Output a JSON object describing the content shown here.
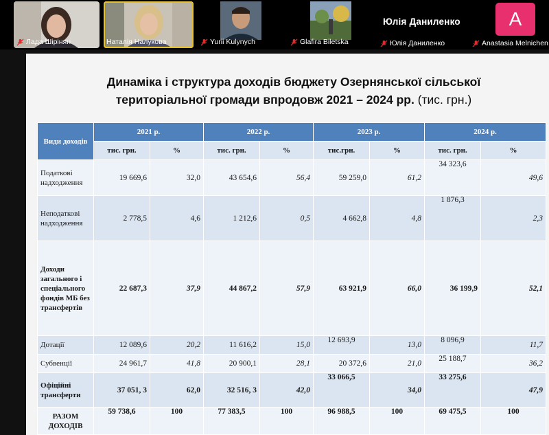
{
  "participants": [
    {
      "name": "Лада Шірінян",
      "mic": "muted"
    },
    {
      "name": "Наталія Налукова",
      "mic": "on",
      "active": true
    },
    {
      "name": "Yurii Kulynych",
      "mic": "muted"
    },
    {
      "name": "Glafira Biletska",
      "mic": "muted"
    },
    {
      "name": "Юлія Даниленко",
      "mic": "muted"
    },
    {
      "name": "Anastasia Melnichen",
      "mic": "muted"
    }
  ],
  "speaker_name": "Юлія Даниленко",
  "avatar_letter": "A",
  "colors": {
    "header_blue": "#4f81bd",
    "row_light": "#dbe5f1",
    "row_lighter": "#eef3f9",
    "avatar_pink": "#e8306e",
    "active_border": "#e6c12a"
  },
  "slide": {
    "title_line1": "Динаміка і структура доходів бюджету  Озернянської сільської",
    "title_line2": "територіальної громади впродовж 2021 – 2024 рр.",
    "title_unit": " (тис. грн.)",
    "table": {
      "corner": "Види доходів",
      "years": [
        "2021 р.",
        "2022 р.",
        "2023 р.",
        "2024 р."
      ],
      "sub": [
        "тис. грн.",
        "%",
        "тис. грн.",
        "%",
        "тис.грн.",
        "%",
        "тис. грн.",
        "%"
      ],
      "rows": [
        {
          "label": "Податкові надходження",
          "values": [
            "19 669,6",
            "32,0",
            "43 654,6",
            "56,4",
            "59 259,0",
            "61,2",
            "34 323,6",
            "49,6"
          ]
        },
        {
          "label": "Неподаткові надходження",
          "values": [
            "2 778,5",
            "4,6",
            "1 212,6",
            "0,5",
            "4 662,8",
            "4,8",
            "1 876,3",
            "2,3"
          ]
        },
        {
          "label": "Доходи загального і спеціального фондів МБ без трансфертів",
          "values": [
            "22  687,3",
            "37,9",
            "44 867,2",
            "57,9",
            "63 921,9",
            "66,0",
            "36 199,9",
            "52,1"
          ]
        },
        {
          "label": "Дотації",
          "values": [
            "12 089,6",
            "20,2",
            "11 616,2",
            "15,0",
            "12 693,9",
            "13,0",
            "8 096,9",
            "11,7"
          ]
        },
        {
          "label": "Субвенції",
          "values": [
            "24 961,7",
            "41,8",
            "20 900,1",
            "28,1",
            "20 372,6",
            "21,0",
            "25 188,7",
            "36,2"
          ]
        },
        {
          "label": "Офіційні трансферти",
          "values": [
            "37 051, 3",
            "62,0",
            "32 516, 3",
            "42,0",
            "33 066,5",
            "34,0",
            "33 275,6",
            "47,9"
          ]
        },
        {
          "label": "РАЗОМ ДОХОДІВ",
          "values": [
            "59 738,6",
            "100",
            "77 383,5",
            "100",
            "96 988,5",
            "100",
            "69 475,5",
            "100"
          ]
        }
      ]
    }
  }
}
